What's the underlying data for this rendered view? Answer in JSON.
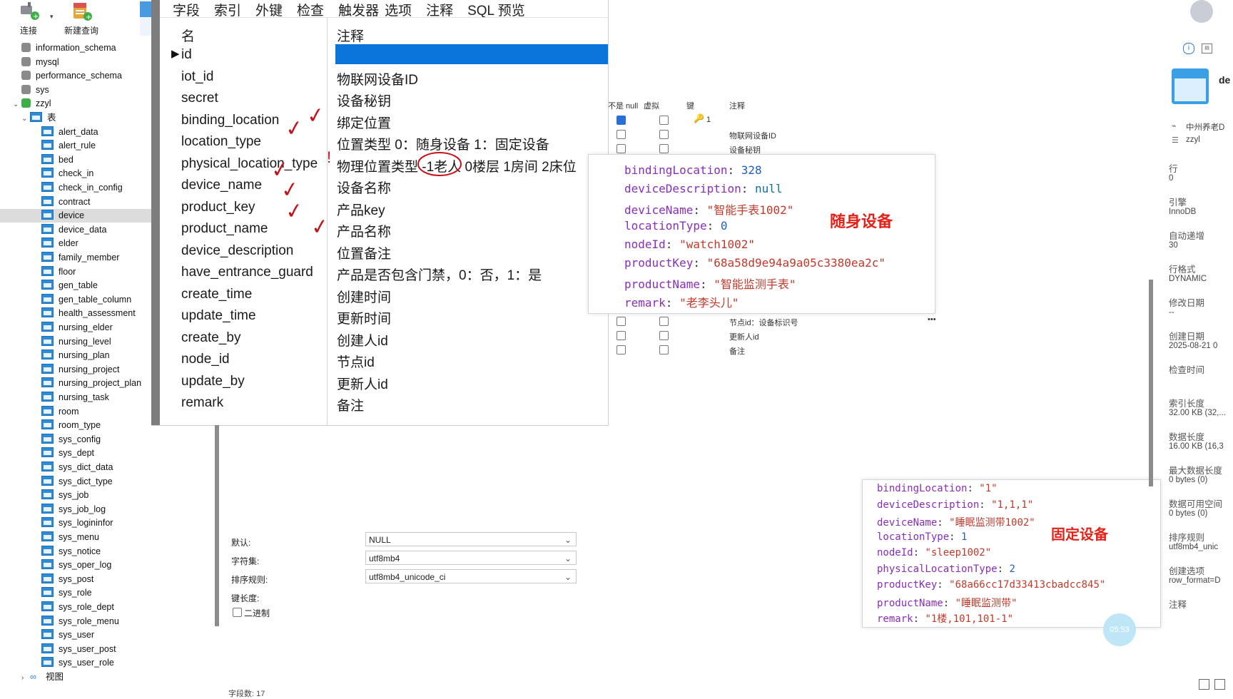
{
  "toolbar": {
    "connect_label": "连接",
    "new_query_label": "新建查询"
  },
  "tree": {
    "databases": [
      "information_schema",
      "mysql",
      "performance_schema",
      "sys",
      "zzyl"
    ],
    "tables_group": "表",
    "tables": [
      "alert_data",
      "alert_rule",
      "bed",
      "check_in",
      "check_in_config",
      "contract",
      "device",
      "device_data",
      "elder",
      "family_member",
      "floor",
      "gen_table",
      "gen_table_column",
      "health_assessment",
      "nursing_elder",
      "nursing_level",
      "nursing_plan",
      "nursing_project",
      "nursing_project_plan",
      "nursing_task",
      "room",
      "room_type",
      "sys_config",
      "sys_dept",
      "sys_dict_data",
      "sys_dict_type",
      "sys_job",
      "sys_job_log",
      "sys_logininfor",
      "sys_menu",
      "sys_notice",
      "sys_oper_log",
      "sys_post",
      "sys_role",
      "sys_role_dept",
      "sys_role_menu",
      "sys_user",
      "sys_user_post",
      "sys_user_role"
    ],
    "selected_table": "device",
    "views_label": "视图"
  },
  "designer": {
    "tabs": [
      "字段",
      "索引",
      "外键",
      "检查",
      "触发器",
      "选项",
      "注释",
      "SQL 预览"
    ],
    "col_name": "名",
    "col_comment": "注释",
    "rows": [
      {
        "name": "id",
        "comment": ""
      },
      {
        "name": "iot_id",
        "comment": "物联网设备ID"
      },
      {
        "name": "secret",
        "comment": "设备秘钥"
      },
      {
        "name": "binding_location",
        "comment": "绑定位置"
      },
      {
        "name": "location_type",
        "comment": "位置类型 0：随身设备 1：固定设备"
      },
      {
        "name": "physical_location_type",
        "comment": "物理位置类型 -1老人 0楼层 1房间 2床位"
      },
      {
        "name": "device_name",
        "comment": "设备名称"
      },
      {
        "name": "product_key",
        "comment": "产品key"
      },
      {
        "name": "product_name",
        "comment": "产品名称"
      },
      {
        "name": "device_description",
        "comment": "位置备注"
      },
      {
        "name": "have_entrance_guard",
        "comment": "产品是否包含门禁，0：否，1：是"
      },
      {
        "name": "create_time",
        "comment": "创建时间"
      },
      {
        "name": "update_time",
        "comment": "更新时间"
      },
      {
        "name": "create_by",
        "comment": "创建人id"
      },
      {
        "name": "node_id",
        "comment": "节点id"
      },
      {
        "name": "update_by",
        "comment": "更新人id"
      },
      {
        "name": "remark",
        "comment": "备注"
      }
    ]
  },
  "background_grid": {
    "headers": [
      "不是 null",
      "虚拟",
      "键",
      "注释"
    ],
    "key_value": "1",
    "comments": [
      "物联网设备ID",
      "设备秘钥",
      "节点id：设备标识号",
      "更新人id",
      "备注"
    ],
    "more": "•••"
  },
  "popup_mobile": {
    "label": "随身设备",
    "lines": [
      {
        "key": "bindingLocation",
        "value": "328",
        "kind": "num"
      },
      {
        "key": "deviceDescription",
        "value": "null",
        "kind": "null"
      },
      {
        "key": "deviceName",
        "value": "\"智能手表1002\"",
        "kind": "str"
      },
      {
        "key": "locationType",
        "value": "0",
        "kind": "num"
      },
      {
        "key": "nodeId",
        "value": "\"watch1002\"",
        "kind": "str"
      },
      {
        "key": "productKey",
        "value": "\"68a58d9e94a9a05c3380ea2c\"",
        "kind": "str"
      },
      {
        "key": "productName",
        "value": "\"智能监测手表\"",
        "kind": "str"
      },
      {
        "key": "remark",
        "value": "\"老李头儿\"",
        "kind": "str"
      }
    ]
  },
  "popup_fixed": {
    "label": "固定设备",
    "lines": [
      {
        "key": "bindingLocation",
        "value": "\"1\"",
        "kind": "str"
      },
      {
        "key": "deviceDescription",
        "value": "\"1,1,1\"",
        "kind": "str"
      },
      {
        "key": "deviceName",
        "value": "\"睡眠监测带1002\"",
        "kind": "str"
      },
      {
        "key": "locationType",
        "value": "1",
        "kind": "num"
      },
      {
        "key": "nodeId",
        "value": "\"sleep1002\"",
        "kind": "str"
      },
      {
        "key": "physicalLocationType",
        "value": "2",
        "kind": "num"
      },
      {
        "key": "productKey",
        "value": "\"68a66cc17d33413cbadcc845\"",
        "kind": "str"
      },
      {
        "key": "productName",
        "value": "\"睡眠监测带\"",
        "kind": "str"
      },
      {
        "key": "remark",
        "value": "\"1楼,101,101-1\"",
        "kind": "str"
      }
    ]
  },
  "field_props": {
    "default_label": "默认:",
    "default_value": "NULL",
    "charset_label": "字符集:",
    "charset_value": "utf8mb4",
    "collation_label": "排序规则:",
    "collation_value": "utf8mb4_unicode_ci",
    "keylen_label": "键长度:",
    "binary_label": "二进制",
    "field_count": "字段数: 17"
  },
  "info_pane": {
    "title_partial": "de",
    "host": "中州养老D",
    "db": "zzyl",
    "items": [
      {
        "label": "行",
        "value": "0"
      },
      {
        "label": "引擎",
        "value": "InnoDB"
      },
      {
        "label": "自动递增",
        "value": "30"
      },
      {
        "label": "行格式",
        "value": "DYNAMIC"
      },
      {
        "label": "修改日期",
        "value": "--"
      },
      {
        "label": "创建日期",
        "value": "2025-08-21 0"
      },
      {
        "label": "检查时间",
        "value": ""
      },
      {
        "label": "索引长度",
        "value": "32.00 KB (32,..."
      },
      {
        "label": "数据长度",
        "value": "16.00 KB (16,3"
      },
      {
        "label": "最大数据长度",
        "value": "0 bytes (0)"
      },
      {
        "label": "数据可用空间",
        "value": "0 bytes (0)"
      },
      {
        "label": "排序规则",
        "value": "utf8mb4_unic"
      },
      {
        "label": "创建选项",
        "value": "row_format=D"
      },
      {
        "label": "注释",
        "value": ""
      }
    ]
  },
  "timer": "05:53"
}
